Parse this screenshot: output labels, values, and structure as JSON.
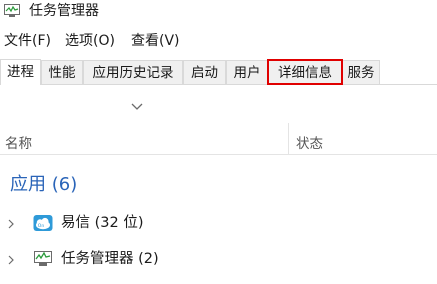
{
  "window": {
    "title": "任务管理器"
  },
  "menu": [
    "文件(F)",
    "选项(O)",
    "查看(V)"
  ],
  "tabs": [
    "进程",
    "性能",
    "应用历史记录",
    "启动",
    "用户",
    "详细信息",
    "服务"
  ],
  "columns": {
    "name": "名称",
    "status": "状态"
  },
  "group": {
    "title": "应用 (6)"
  },
  "rows": [
    {
      "label": "易信 (32 位)",
      "icon": "yixin-cloud-icon"
    },
    {
      "label": "任务管理器 (2)",
      "icon": "task-manager-icon"
    }
  ],
  "colors": {
    "accent": "#2a64b8",
    "highlight": "#e00000"
  }
}
